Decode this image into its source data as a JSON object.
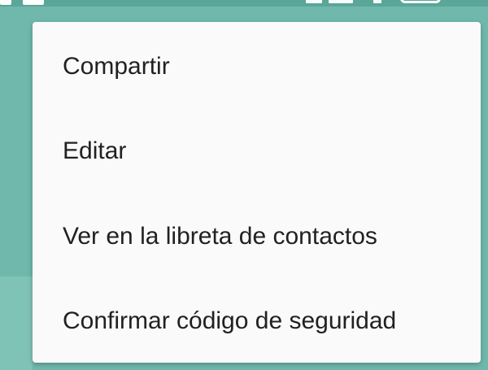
{
  "menu": {
    "items": [
      {
        "label": "Compartir"
      },
      {
        "label": "Editar"
      },
      {
        "label": "Ver en la libreta de contactos"
      },
      {
        "label": "Confirmar código de seguridad"
      }
    ]
  },
  "status_bar": {
    "icons": [
      "app-icon",
      "message-icon",
      "vibrate-icon",
      "signal-icon",
      "wifi-icon",
      "battery-icon"
    ]
  },
  "colors": {
    "background": "#6fb8ab",
    "menu_background": "#fafafa",
    "menu_text": "#212121"
  }
}
